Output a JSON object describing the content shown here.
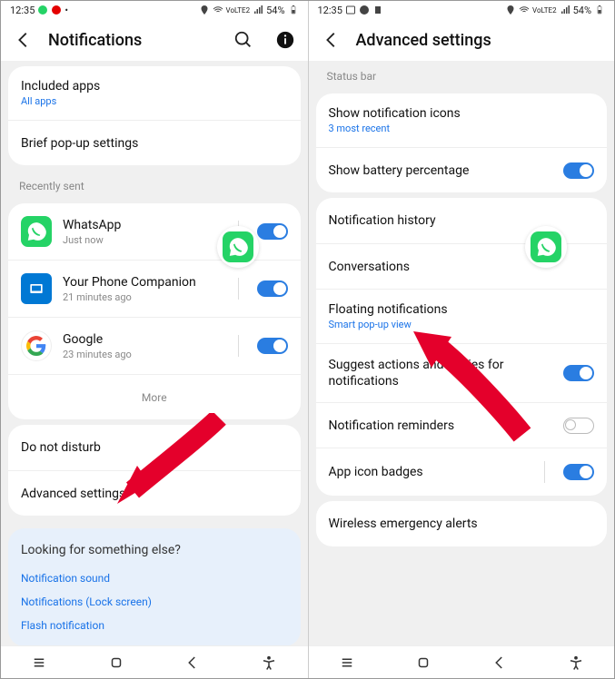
{
  "status": {
    "time": "12:35",
    "battery": "54%",
    "net": "VoLTE2"
  },
  "left": {
    "title": "Notifications",
    "included": {
      "title": "Included apps",
      "sub": "All apps"
    },
    "brief": "Brief pop-up settings",
    "recently_label": "Recently sent",
    "apps": [
      {
        "name": "WhatsApp",
        "time": "Just now"
      },
      {
        "name": "Your Phone Companion",
        "time": "21 minutes ago"
      },
      {
        "name": "Google",
        "time": "23 minutes ago"
      }
    ],
    "more": "More",
    "dnd": "Do not disturb",
    "advanced": "Advanced settings",
    "looking": {
      "q": "Looking for something else?",
      "links": [
        "Notification sound",
        "Notifications (Lock screen)",
        "Flash notification"
      ]
    }
  },
  "right": {
    "title": "Advanced settings",
    "status_bar_label": "Status bar",
    "show_icons": {
      "title": "Show notification icons",
      "sub": "3 most recent"
    },
    "battery_pct": "Show battery percentage",
    "history": "Notification history",
    "conversations": "Conversations",
    "floating": {
      "title": "Floating notifications",
      "sub": "Smart pop-up view"
    },
    "suggest": "Suggest actions and replies for notifications",
    "reminders": "Notification reminders",
    "badges": "App icon badges",
    "wireless": "Wireless emergency alerts"
  }
}
